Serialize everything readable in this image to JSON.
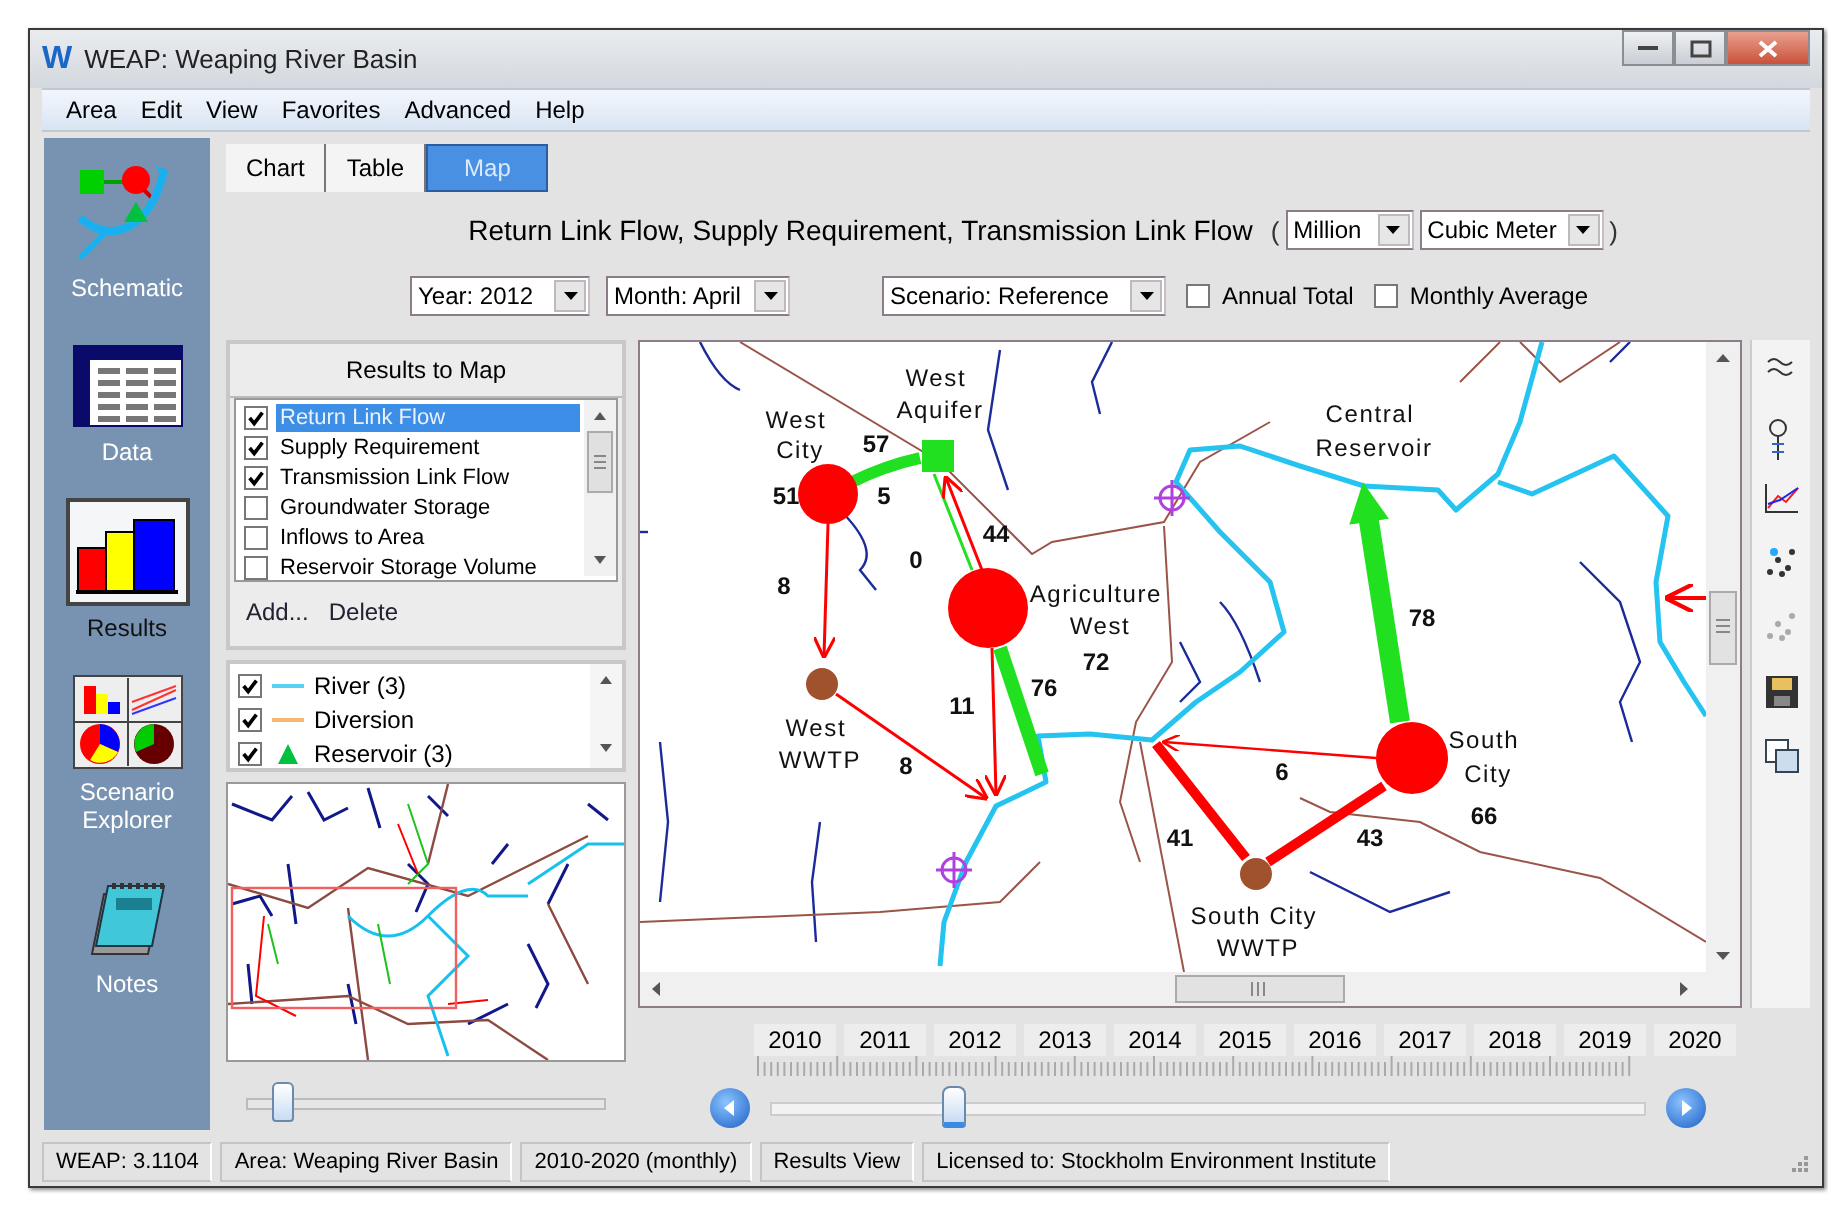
{
  "window": {
    "logo": "W",
    "title": "WEAP: Weaping River Basin"
  },
  "menu": [
    "Area",
    "Edit",
    "View",
    "Favorites",
    "Advanced",
    "Help"
  ],
  "sidebar": {
    "items": [
      {
        "label": "Schematic",
        "kind": "schematic",
        "selected": false
      },
      {
        "label": "Data",
        "kind": "data",
        "selected": false
      },
      {
        "label": "Results",
        "kind": "results",
        "selected": true
      },
      {
        "label": "Scenario Explorer",
        "kind": "explorer",
        "selected": false
      },
      {
        "label": "Notes",
        "kind": "notes",
        "selected": false
      }
    ]
  },
  "tabs": [
    {
      "label": "Chart",
      "selected": false
    },
    {
      "label": "Table",
      "selected": false
    },
    {
      "label": "Map",
      "selected": true
    }
  ],
  "result_title": "Return Link Flow, Supply Requirement, Transmission Link Flow",
  "unit_open": "(",
  "unit_close": ")",
  "units": [
    "Million",
    "Cubic Meter"
  ],
  "filters": [
    "Year: 2012",
    "Month: April",
    "Scenario: Reference"
  ],
  "options": [
    {
      "label": "Annual Total",
      "checked": false
    },
    {
      "label": "Monthly Average",
      "checked": false
    }
  ],
  "results_to_map": {
    "title": "Results to Map",
    "items": [
      {
        "label": "Return Link Flow",
        "checked": true,
        "selected": true
      },
      {
        "label": "Supply Requirement",
        "checked": true,
        "selected": false
      },
      {
        "label": "Transmission Link Flow",
        "checked": true,
        "selected": false
      },
      {
        "label": "Groundwater Storage",
        "checked": false,
        "selected": false
      },
      {
        "label": "Inflows to Area",
        "checked": false,
        "selected": false
      },
      {
        "label": "Reservoir Storage Volume",
        "checked": false,
        "selected": false
      }
    ],
    "buttons": [
      "Add...",
      "Delete"
    ]
  },
  "legend": {
    "items": [
      {
        "label": "River (3)",
        "checked": true,
        "kind": "line",
        "color": "#5cd0f4"
      },
      {
        "label": "Diversion",
        "checked": true,
        "kind": "line",
        "color": "#f4b870"
      },
      {
        "label": "Reservoir (3)",
        "checked": true,
        "kind": "triangle",
        "color": "#00c040"
      }
    ]
  },
  "zoom_slider": {
    "level": 0.1
  },
  "map": {
    "nodes": [
      {
        "name": "West City",
        "value": "51",
        "kind": "demand"
      },
      {
        "name": "West Aquifer",
        "kind": "groundwater"
      },
      {
        "name": "Agriculture West",
        "value": "72",
        "kind": "demand"
      },
      {
        "name": "West WWTP",
        "kind": "treatment"
      },
      {
        "name": "Central Reservoir",
        "kind": "reservoir"
      },
      {
        "name": "South City",
        "value": "66",
        "kind": "demand"
      },
      {
        "name": "South City WWTP",
        "kind": "treatment"
      }
    ],
    "links": [
      {
        "kind": "transmission"
      },
      {
        "kind": "transmission"
      },
      {
        "kind": "return"
      },
      {
        "kind": "return"
      },
      {
        "kind": "return"
      },
      {
        "kind": "return"
      },
      {
        "kind": "transmission"
      },
      {
        "kind": "transmission"
      },
      {
        "kind": "return"
      },
      {
        "kind": "return"
      },
      {
        "kind": "return"
      },
      {
        "kind": "return"
      }
    ],
    "flow_labels": [
      "57",
      "5",
      "0",
      "44",
      "8",
      "11",
      "76",
      "8",
      "78",
      "6",
      "41",
      "43"
    ]
  },
  "timeline": {
    "years": [
      "2010",
      "2011",
      "2012",
      "2013",
      "2014",
      "2015",
      "2016",
      "2017",
      "2018",
      "2019",
      "2020"
    ],
    "level": 0.21
  },
  "status_bar": [
    "WEAP: 3.1104",
    "Area: Weaping River Basin",
    "2010-2020 (monthly)",
    "Results View",
    "Licensed to: Stockholm Environment Institute"
  ]
}
